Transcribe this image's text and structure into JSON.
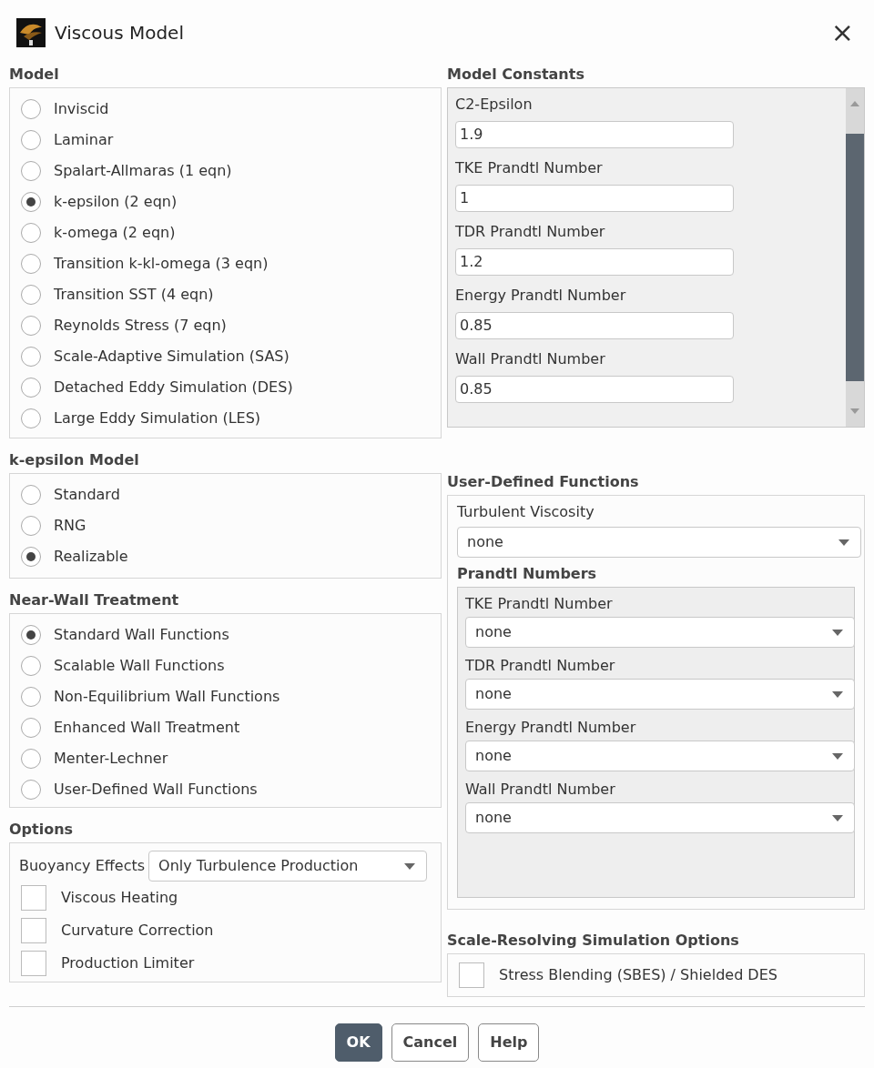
{
  "window": {
    "title": "Viscous Model",
    "close": "×"
  },
  "model": {
    "heading": "Model",
    "options": [
      {
        "label": "Inviscid",
        "selected": false
      },
      {
        "label": "Laminar",
        "selected": false
      },
      {
        "label": "Spalart-Allmaras (1 eqn)",
        "selected": false
      },
      {
        "label": "k-epsilon (2 eqn)",
        "selected": true
      },
      {
        "label": "k-omega (2 eqn)",
        "selected": false
      },
      {
        "label": "Transition k-kl-omega (3 eqn)",
        "selected": false
      },
      {
        "label": "Transition SST (4 eqn)",
        "selected": false
      },
      {
        "label": "Reynolds Stress (7 eqn)",
        "selected": false
      },
      {
        "label": "Scale-Adaptive Simulation (SAS)",
        "selected": false
      },
      {
        "label": "Detached Eddy Simulation (DES)",
        "selected": false
      },
      {
        "label": "Large Eddy Simulation (LES)",
        "selected": false
      }
    ]
  },
  "k_epsilon_model": {
    "heading": "k-epsilon Model",
    "options": [
      {
        "label": "Standard",
        "selected": false
      },
      {
        "label": "RNG",
        "selected": false
      },
      {
        "label": "Realizable",
        "selected": true
      }
    ]
  },
  "near_wall_treatment": {
    "heading": "Near-Wall Treatment",
    "options": [
      {
        "label": "Standard Wall Functions",
        "selected": true
      },
      {
        "label": "Scalable Wall Functions",
        "selected": false
      },
      {
        "label": "Non-Equilibrium Wall Functions",
        "selected": false
      },
      {
        "label": "Enhanced Wall Treatment",
        "selected": false
      },
      {
        "label": "Menter-Lechner",
        "selected": false
      },
      {
        "label": "User-Defined Wall Functions",
        "selected": false
      }
    ]
  },
  "options": {
    "heading": "Options",
    "buoyancy": {
      "label": "Buoyancy Effects",
      "value": "Only Turbulence Production"
    },
    "checkboxes": [
      {
        "label": "Viscous Heating",
        "checked": false
      },
      {
        "label": "Curvature Correction",
        "checked": false
      },
      {
        "label": "Production Limiter",
        "checked": false
      }
    ]
  },
  "model_constants": {
    "heading": "Model Constants",
    "fields": [
      {
        "label": "C2-Epsilon",
        "value": "1.9"
      },
      {
        "label": "TKE Prandtl Number",
        "value": "1"
      },
      {
        "label": "TDR Prandtl Number",
        "value": "1.2"
      },
      {
        "label": "Energy Prandtl Number",
        "value": "0.85"
      },
      {
        "label": "Wall Prandtl Number",
        "value": "0.85"
      }
    ]
  },
  "user_defined_functions": {
    "heading": "User-Defined Functions",
    "turbulent_viscosity": {
      "label": "Turbulent Viscosity",
      "value": "none"
    },
    "prandtl_numbers": {
      "heading": "Prandtl Numbers",
      "fields": [
        {
          "label": "TKE Prandtl Number",
          "value": "none"
        },
        {
          "label": "TDR Prandtl Number",
          "value": "none"
        },
        {
          "label": "Energy Prandtl Number",
          "value": "none"
        },
        {
          "label": "Wall Prandtl Number",
          "value": "none"
        }
      ]
    }
  },
  "scale_resolving": {
    "heading": "Scale-Resolving Simulation Options",
    "checkboxes": [
      {
        "label": "Stress Blending (SBES) / Shielded DES",
        "checked": false
      }
    ]
  },
  "buttons": [
    {
      "label": "OK",
      "kind": "primary"
    },
    {
      "label": "Cancel",
      "kind": "default"
    },
    {
      "label": "Help",
      "kind": "default"
    }
  ]
}
